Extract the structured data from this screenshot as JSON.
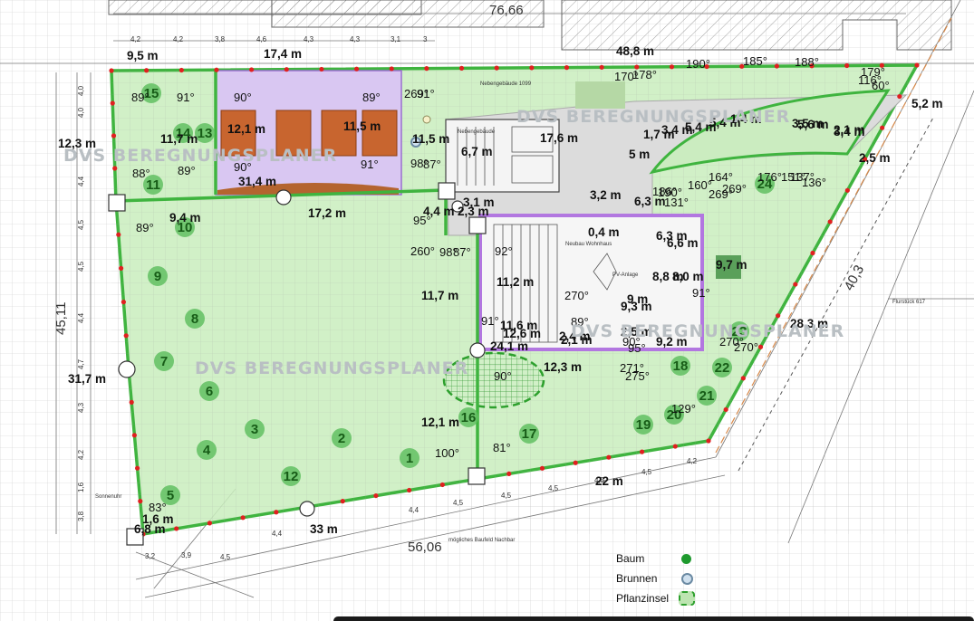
{
  "title_dim": "76,66",
  "watermark": "DVS BEREGNUNGSPLANER",
  "segment_labels": [
    "48,8 m",
    "9,5 m",
    "17,4 m",
    "12,3 m",
    "11,7 m",
    "12,1 m",
    "11,5 m",
    "11,5 m",
    "31,4 m",
    "17,2 m",
    "9,4 m",
    "6,7 m",
    "17,6 m",
    "3,1 m",
    "4,4 m",
    "2,3 m",
    "1,7 m",
    "3,4 m",
    "5,4 m",
    "5,4 m",
    "1,4 m",
    "3,5 m",
    "5,6 m",
    "2,1 m",
    "3,4 m",
    "2,5 m",
    "5,2 m",
    "5 m",
    "3,2 m",
    "6,3 m",
    "0,4 m",
    "6,3 m",
    "6,6 m",
    "9,7 m",
    "11,2 m",
    "11,7 m",
    "8,8 m",
    "8,0 m",
    "9 m",
    "9,3 m",
    "11,6 m",
    "12,6 m",
    "2,5 m",
    "2,4 m",
    "2,1 m",
    "24,1 m",
    "9,2 m",
    "28,3 m",
    "12,3 m",
    "31,7 m",
    "12,1 m",
    "33 m",
    "22 m",
    "1,6 m",
    "6,8 m"
  ],
  "angles": [
    "89°",
    "91°",
    "90°",
    "89°",
    "269°",
    "91°",
    "88°",
    "89°",
    "90°",
    "91°",
    "98°",
    "87°",
    "170°",
    "178°",
    "190°",
    "185°",
    "188°",
    "179°",
    "116°",
    "60°",
    "186°",
    "190°",
    "131°",
    "160°",
    "164°",
    "269°",
    "269°",
    "176°",
    "151°",
    "137°",
    "136°",
    "89°",
    "95°",
    "260°",
    "98°",
    "87°",
    "92°",
    "270°",
    "91°",
    "91°",
    "89°",
    "90°",
    "95°",
    "270°",
    "270°",
    "90°",
    "271°",
    "275°",
    "129°",
    "81°",
    "100°",
    "83°"
  ],
  "zones": [
    "15",
    "14",
    "11",
    "13",
    "10",
    "9",
    "8",
    "7",
    "6",
    "5",
    "4",
    "3",
    "2",
    "12",
    "1",
    "16",
    "17",
    "19",
    "18",
    "20",
    "21",
    "22",
    "23",
    "24"
  ],
  "cad_dims_top": [
    "4,2",
    "4,2",
    "3,8",
    "4,6",
    "4,3",
    "4,3",
    "3,1",
    "3"
  ],
  "cad_dims_left": [
    "4,0",
    "4,0",
    "4,4",
    "4,5",
    "4,5",
    "4,4",
    "4,7",
    "4,3",
    "4,2",
    "3,8",
    "1,6"
  ],
  "cad_dims_bottom": [
    "4,5",
    "4,5",
    "4,5",
    "4,5",
    "4,4",
    "4,5",
    "4,2",
    "4,4",
    "3,2",
    "3,9",
    "4,5",
    "56,06",
    "40,3",
    "45,11"
  ],
  "cad_labels": {
    "nebengebaeude_top": "Nebengebäude 1099",
    "nebengebaeude": "Nebengebäude",
    "neubau": "Neubau Wohnhaus",
    "flurstueck": "Flurstück 617",
    "baufeld": "mögliches Baufeld Nachbar",
    "sonnenuhr": "Sonnenuhr",
    "pv_anlage": "PV-Anlage"
  },
  "legend": {
    "tree": "Baum",
    "well": "Brunnen",
    "isle": "Pflanzinsel"
  },
  "colors": {
    "lawn": "#c9edbd",
    "border": "#3fb43f",
    "room": "#d9c7f2",
    "house": "#b277e0",
    "zone": "#62bf62"
  }
}
